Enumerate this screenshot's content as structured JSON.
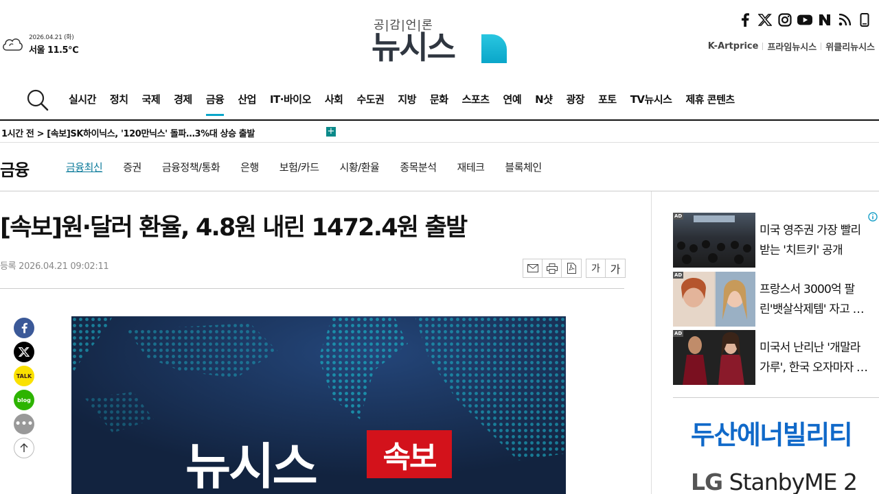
{
  "weather": {
    "date": "2026.04.21 (화)",
    "temp": "서울 11.5℃",
    "icon": "cloud-icon"
  },
  "logo": {
    "slogan": "공|감|언|론",
    "wordmark": "뉴시스",
    "brand_color": "#0aa6c9"
  },
  "social": [
    "facebook-icon",
    "x-icon",
    "instagram-icon",
    "youtube-icon",
    "naver-icon",
    "rss-icon",
    "mobile-icon"
  ],
  "toplinks": [
    "K-Artprice",
    "프라임뉴시스",
    "위클리뉴시스"
  ],
  "mainnav": {
    "items": [
      "실시간",
      "정치",
      "국제",
      "경제",
      "금융",
      "산업",
      "IT·바이오",
      "사회",
      "수도권",
      "지방",
      "문화",
      "스포츠",
      "연예",
      "N샷",
      "광장",
      "포토",
      "TV뉴시스",
      "제휴 콘텐츠"
    ],
    "active": "금융"
  },
  "ticker": {
    "text": "1시간 전 > [속보]SK하이닉스, '120만닉스' 돌파…3%대 상승 출발",
    "more": "+"
  },
  "section": {
    "title": "금융",
    "items": [
      "금융최신",
      "증권",
      "금융정책/통화",
      "은행",
      "보험/카드",
      "시황/환율",
      "종목분석",
      "재테크",
      "블록체인"
    ],
    "active": "금융최신"
  },
  "article": {
    "headline": "[속보]원·달러 환율, 4.8원 내린 1472.4원 출발",
    "dateline": "등록 2026.04.21 09:02:11",
    "tools": {
      "font_small": "가",
      "font_large": "가"
    },
    "photo": {
      "brand": "뉴시스",
      "badge": "속보"
    }
  },
  "shares": [
    "facebook-icon",
    "x-icon",
    "kakaotalk-icon",
    "blog-icon",
    "comment-icon",
    "scroll-top-icon"
  ],
  "ads": [
    {
      "line1": "미국 영주권 가장 빨리",
      "line2": "받는 '치트키' 공개",
      "tag": "AD"
    },
    {
      "line1": "프랑스서 3000억 팔",
      "line2": "린'뱃살삭제템' 자고 …",
      "tag": "AD"
    },
    {
      "line1": "미국서 난리난 '개말라",
      "line2": "가루', 한국 오자마자 …",
      "tag": "AD"
    }
  ],
  "banners": {
    "doosan": "두산에너빌리티",
    "lg_brand": "LG",
    "lg_product": "StanbyME 2"
  }
}
